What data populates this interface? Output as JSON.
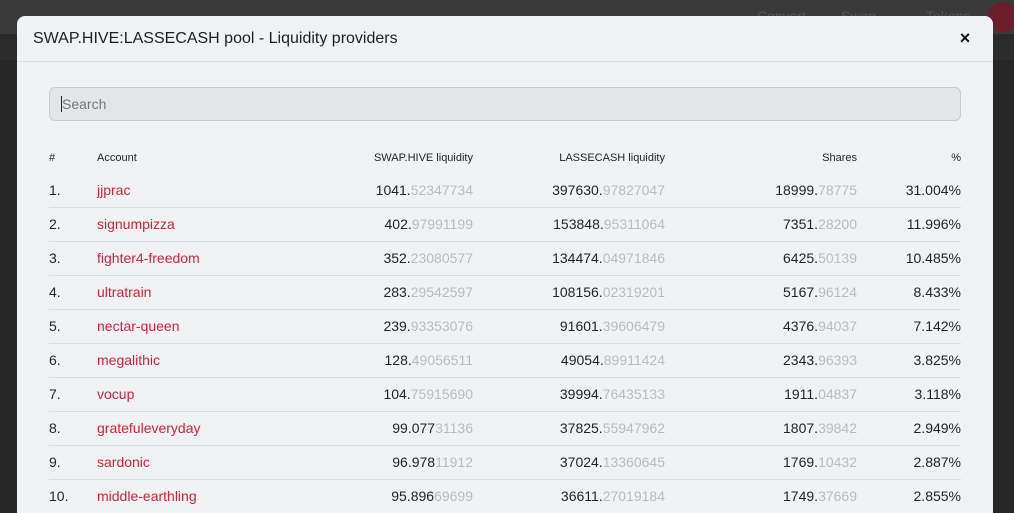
{
  "background": {
    "nav_items": [
      "Convert",
      "Swap",
      "Tokens"
    ]
  },
  "modal": {
    "title": "SWAP.HIVE:LASSECASH pool - Liquidity providers",
    "close_label": "×"
  },
  "search": {
    "placeholder": "Search",
    "value": ""
  },
  "table": {
    "headers": {
      "num": "#",
      "account": "Account",
      "hive": "SWAP.HIVE liquidity",
      "lassecash": "LASSECASH liquidity",
      "shares": "Shares",
      "pct": "%"
    },
    "rows": [
      {
        "num": "1.",
        "account": "jjprac",
        "hive_int": "1041.",
        "hive_dec": "52347734",
        "lc_int": "397630.",
        "lc_dec": "97827047",
        "sh_int": "18999.",
        "sh_dec": "78775",
        "pct": "31.004%"
      },
      {
        "num": "2.",
        "account": "signumpizza",
        "hive_int": "402.",
        "hive_dec": "97991199",
        "lc_int": "153848.",
        "lc_dec": "95311064",
        "sh_int": "7351.",
        "sh_dec": "28200",
        "pct": "11.996%"
      },
      {
        "num": "3.",
        "account": "fighter4-freedom",
        "hive_int": "352.",
        "hive_dec": "23080577",
        "lc_int": "134474.",
        "lc_dec": "04971846",
        "sh_int": "6425.",
        "sh_dec": "50139",
        "pct": "10.485%"
      },
      {
        "num": "4.",
        "account": "ultratrain",
        "hive_int": "283.",
        "hive_dec": "29542597",
        "lc_int": "108156.",
        "lc_dec": "02319201",
        "sh_int": "5167.",
        "sh_dec": "96124",
        "pct": "8.433%"
      },
      {
        "num": "5.",
        "account": "nectar-queen",
        "hive_int": "239.",
        "hive_dec": "93353076",
        "lc_int": "91601.",
        "lc_dec": "39606479",
        "sh_int": "4376.",
        "sh_dec": "94037",
        "pct": "7.142%"
      },
      {
        "num": "6.",
        "account": "megalithic",
        "hive_int": "128.",
        "hive_dec": "49056511",
        "lc_int": "49054.",
        "lc_dec": "89911424",
        "sh_int": "2343.",
        "sh_dec": "96393",
        "pct": "3.825%"
      },
      {
        "num": "7.",
        "account": "vocup",
        "hive_int": "104.",
        "hive_dec": "75915690",
        "lc_int": "39994.",
        "lc_dec": "76435133",
        "sh_int": "1911.",
        "sh_dec": "04837",
        "pct": "3.118%"
      },
      {
        "num": "8.",
        "account": "gratefuleveryday",
        "hive_int": "99.077",
        "hive_dec": "31136",
        "lc_int": "37825.",
        "lc_dec": "55947962",
        "sh_int": "1807.",
        "sh_dec": "39842",
        "pct": "2.949%"
      },
      {
        "num": "9.",
        "account": "sardonic",
        "hive_int": "96.978",
        "hive_dec": "11912",
        "lc_int": "37024.",
        "lc_dec": "13360645",
        "sh_int": "1769.",
        "sh_dec": "10432",
        "pct": "2.887%"
      },
      {
        "num": "10.",
        "account": "middle-earthling",
        "hive_int": "95.896",
        "hive_dec": "69699",
        "lc_int": "36611.",
        "lc_dec": "27019184",
        "sh_int": "1749.",
        "sh_dec": "37669",
        "pct": "2.855%"
      }
    ]
  },
  "colors": {
    "accent": "#d0223b",
    "decimal_muted": "#b8bbc0",
    "modal_bg": "#f1f2f4"
  }
}
